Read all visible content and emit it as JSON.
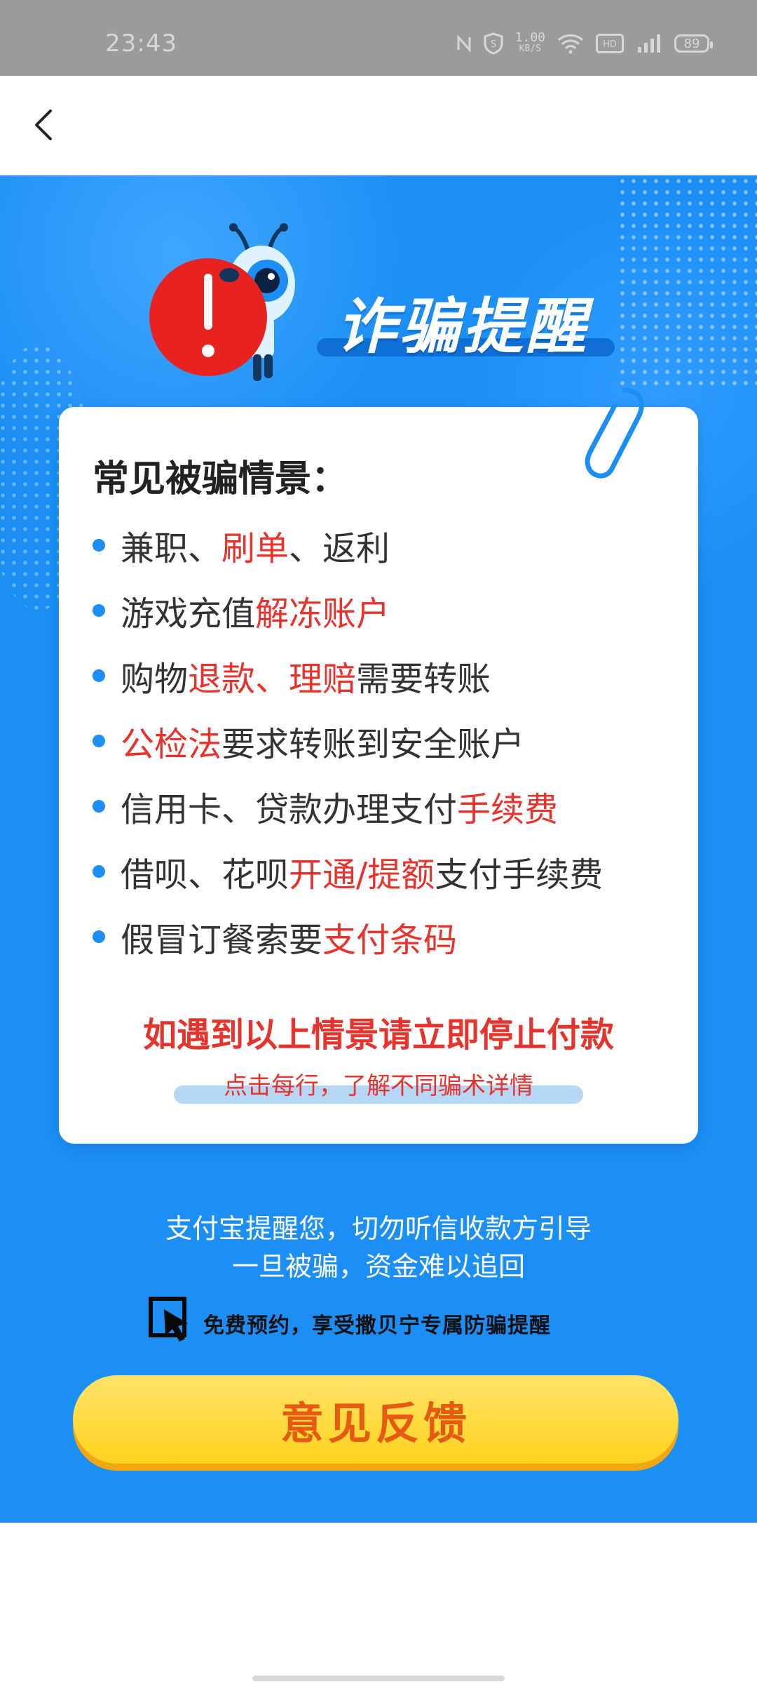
{
  "status_bar": {
    "time": "23:43",
    "net_speed_value": "1.00",
    "net_speed_unit": "KB/S",
    "battery": "89"
  },
  "header": {
    "title": "诈骗提醒"
  },
  "card": {
    "title": "常见被骗情景：",
    "items": [
      {
        "segments": [
          {
            "text": "兼职、",
            "red": false
          },
          {
            "text": "刷单",
            "red": true
          },
          {
            "text": "、返利",
            "red": false
          }
        ]
      },
      {
        "segments": [
          {
            "text": "游戏充值",
            "red": false
          },
          {
            "text": "解冻账户",
            "red": true
          }
        ]
      },
      {
        "segments": [
          {
            "text": "购物",
            "red": false
          },
          {
            "text": "退款、理赔",
            "red": true
          },
          {
            "text": "需要转账",
            "red": false
          }
        ]
      },
      {
        "segments": [
          {
            "text": "公检法",
            "red": true
          },
          {
            "text": "要求转账到安全账户",
            "red": false
          }
        ]
      },
      {
        "segments": [
          {
            "text": "信用卡、贷款办理支付",
            "red": false
          },
          {
            "text": "手续费",
            "red": true
          }
        ]
      },
      {
        "segments": [
          {
            "text": "借呗、花呗",
            "red": false
          },
          {
            "text": "开通/提额",
            "red": true
          },
          {
            "text": "支付手续费",
            "red": false
          }
        ]
      },
      {
        "segments": [
          {
            "text": "假冒订餐索要",
            "red": false
          },
          {
            "text": "支付条码",
            "red": true
          }
        ]
      }
    ],
    "warning": "如遇到以上情景请立即停止付款",
    "hint": "点击每行，了解不同骗术详情"
  },
  "reminder": {
    "line1": "支付宝提醒您，切勿听信收款方引导",
    "line2": "一旦被骗，资金难以追回"
  },
  "booking_text": "免费预约，享受撒贝宁专属防骗提醒",
  "feedback_button": "意见反馈",
  "colors": {
    "primary_blue": "#1b8ff5",
    "alert_red": "#e8322c",
    "button_yellow": "#ffd21a",
    "button_text": "#e65a14"
  }
}
